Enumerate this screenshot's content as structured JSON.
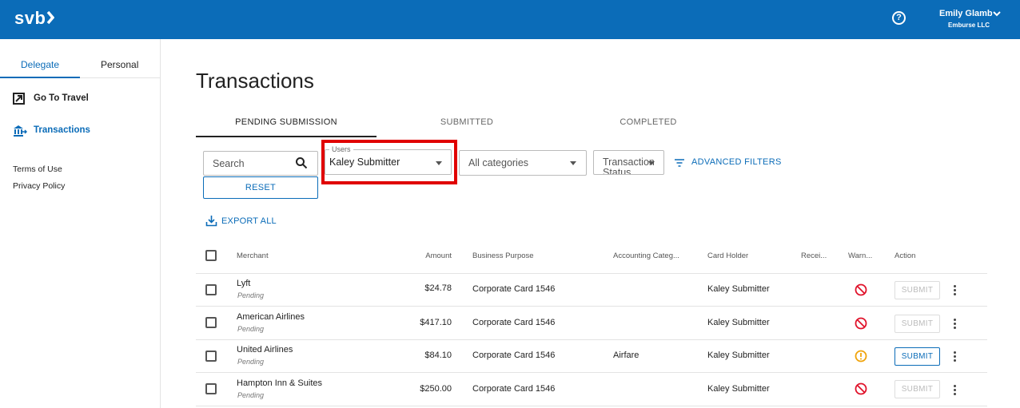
{
  "header": {
    "logo": "svb",
    "user_name": "Emily Glamb",
    "user_org": "Emburse LLC",
    "help_icon": "question-circle-icon",
    "brand_color": "#0b6cb8"
  },
  "sidebar": {
    "tabs": [
      {
        "label": "Delegate",
        "active": true
      },
      {
        "label": "Personal",
        "active": false
      }
    ],
    "items": [
      {
        "label": "Go To Travel",
        "icon": "external-window-icon"
      },
      {
        "label": "Transactions",
        "icon": "bank-transfer-icon",
        "active": true
      }
    ],
    "links": [
      {
        "label": "Terms of Use"
      },
      {
        "label": "Privacy Policy"
      }
    ]
  },
  "page": {
    "title": "Transactions",
    "tabs": [
      {
        "label": "PENDING SUBMISSION",
        "active": true
      },
      {
        "label": "SUBMITTED",
        "active": false
      },
      {
        "label": "COMPLETED",
        "active": false
      }
    ]
  },
  "filters": {
    "search_placeholder": "Search",
    "reset_label": "RESET",
    "users_legend": "Users",
    "users_value": "Kaley Submitter",
    "category_value": "All categories",
    "status_value": "Transaction Status",
    "advanced_label": "ADVANCED FILTERS",
    "export_label": "EXPORT ALL"
  },
  "table": {
    "columns": [
      "Merchant",
      "Amount",
      "Business Purpose",
      "Accounting Categ...",
      "Card Holder",
      "Recei...",
      "Warn...",
      "Action"
    ],
    "rows": [
      {
        "merchant": "Lyft",
        "status": "Pending",
        "amount": "$24.78",
        "purpose": "Corporate Card 1546",
        "category": "",
        "holder": "Kaley Submitter",
        "warning": "blocked",
        "action": "SUBMIT",
        "action_enabled": false
      },
      {
        "merchant": "American Airlines",
        "status": "Pending",
        "amount": "$417.10",
        "purpose": "Corporate Card 1546",
        "category": "",
        "holder": "Kaley Submitter",
        "warning": "blocked",
        "action": "SUBMIT",
        "action_enabled": false
      },
      {
        "merchant": "United Airlines",
        "status": "Pending",
        "amount": "$84.10",
        "purpose": "Corporate Card 1546",
        "category": "Airfare",
        "holder": "Kaley Submitter",
        "warning": "alert",
        "action": "SUBMIT",
        "action_enabled": true
      },
      {
        "merchant": "Hampton Inn & Suites",
        "status": "Pending",
        "amount": "$250.00",
        "purpose": "Corporate Card 1546",
        "category": "",
        "holder": "Kaley Submitter",
        "warning": "blocked",
        "action": "SUBMIT",
        "action_enabled": false
      }
    ]
  }
}
